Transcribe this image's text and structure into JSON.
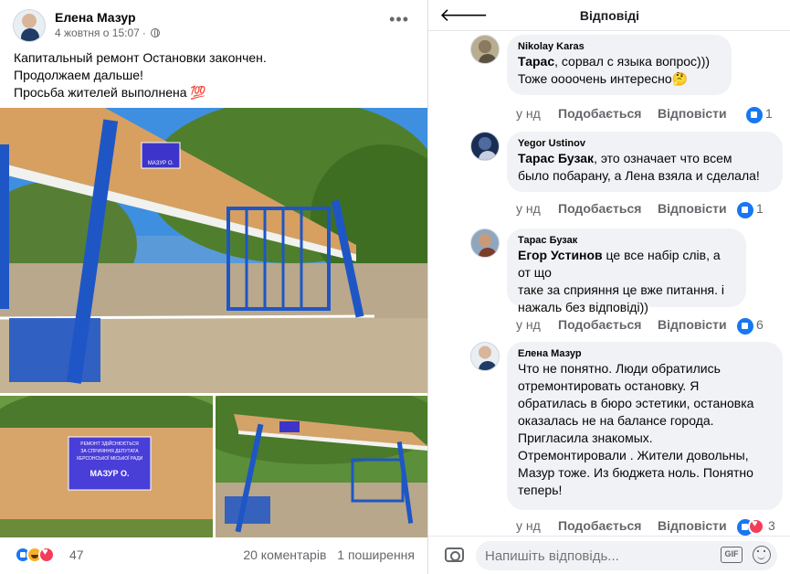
{
  "post": {
    "author": "Елена Мазур",
    "timestamp": "4 жовтня о 15:07",
    "text_lines": [
      "Капитальный ремонт Остановки закончен.",
      "Продолжаем дальше!",
      "Просьба жителей выполнена 💯"
    ],
    "photos": {
      "main_sign": "МАЗУР О.",
      "closeup_sign": [
        "РЕМОНТ ЗДІЙСНЮЄТЬСЯ",
        "ЗА СПРИЯННЯ ДЕПУТАТА",
        "ХЕРСОНСЬКОЇ МІСЬКОЇ РАДИ",
        "МАЗУР О."
      ]
    },
    "reaction_count": "47",
    "comments_count": "20 коментарів",
    "shares_count": "1 поширення"
  },
  "panel": {
    "title": "Відповіді",
    "comments": [
      {
        "name": "Nikolay  Karas",
        "mention": "Тарас",
        "lines": [
          ", сорвал с языка вопрос)))",
          "Тоже оооочень интересно🤔"
        ],
        "time": "у нд",
        "like_label": "Подобається",
        "reply_label": "Відповісти",
        "reactions": "1"
      },
      {
        "name": "Yegor Ustinov",
        "mention": "Тарас Бузак",
        "lines": [
          ", это означает что всем",
          "было побарану, а Лена взяла и сделала!"
        ],
        "time": "у нд",
        "like_label": "Подобається",
        "reply_label": "Відповісти",
        "reactions": "1"
      },
      {
        "name": "Тарас Бузак",
        "mention": "Егор Устинов",
        "lines": [
          "  це все набір слів, а от що",
          "таке  за сприяння це вже питання. і",
          "нажаль без відповіді))"
        ],
        "time": "у нд",
        "like_label": "Подобається",
        "reply_label": "Відповісти",
        "reactions": "6"
      },
      {
        "name": "Елена Мазур",
        "mention": "",
        "lines": [
          "Что не понятно. Люди обратились",
          "отремонтировать остановку. Я",
          "обратилась в бюро эстетики, остановка",
          "оказалась не на балансе города.",
          "Пригласила знакомых.",
          "Отремонтировали . Жители довольны,",
          "Мазур тоже. Из бюджета ноль. Понятно",
          "теперь!"
        ],
        "time": "у нд",
        "like_label": "Подобається",
        "reply_label": "Відповісти",
        "reactions": "3"
      }
    ],
    "reply_placeholder": "Напишіть відповідь...",
    "gif_label": "GIF"
  },
  "colors": {
    "accent": "#1877f2",
    "bubble": "#f0f2f5",
    "secondary_text": "#65676b"
  }
}
